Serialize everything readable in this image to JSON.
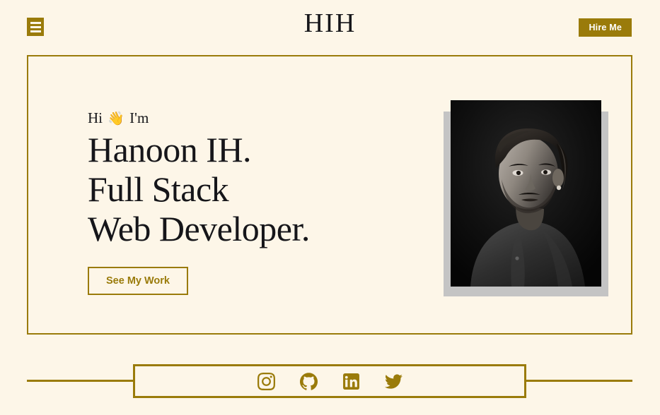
{
  "header": {
    "menu_icon": "hamburger-menu-icon",
    "logo": "HIH",
    "hire_label": "Hire Me"
  },
  "hero": {
    "greeting_prefix": "Hi",
    "greeting_emoji": "👋",
    "greeting_suffix": "I'm",
    "headline_line1": "Hanoon IH.",
    "headline_line2": "Full Stack",
    "headline_line3": "Web Developer.",
    "cta_label": "See My Work",
    "portrait_alt": "black-and-white portrait photo of a man in a denim shirt"
  },
  "footer": {
    "socials": [
      {
        "name": "instagram",
        "label": "Instagram"
      },
      {
        "name": "github",
        "label": "GitHub"
      },
      {
        "name": "linkedin",
        "label": "LinkedIn"
      },
      {
        "name": "twitter",
        "label": "Twitter"
      }
    ]
  },
  "colors": {
    "background": "#FDF6E8",
    "gold": "#9A7B0A",
    "ink": "#16161A",
    "shadow_gray": "#C4C4C4",
    "wave_skin": "#E8C4AE"
  }
}
